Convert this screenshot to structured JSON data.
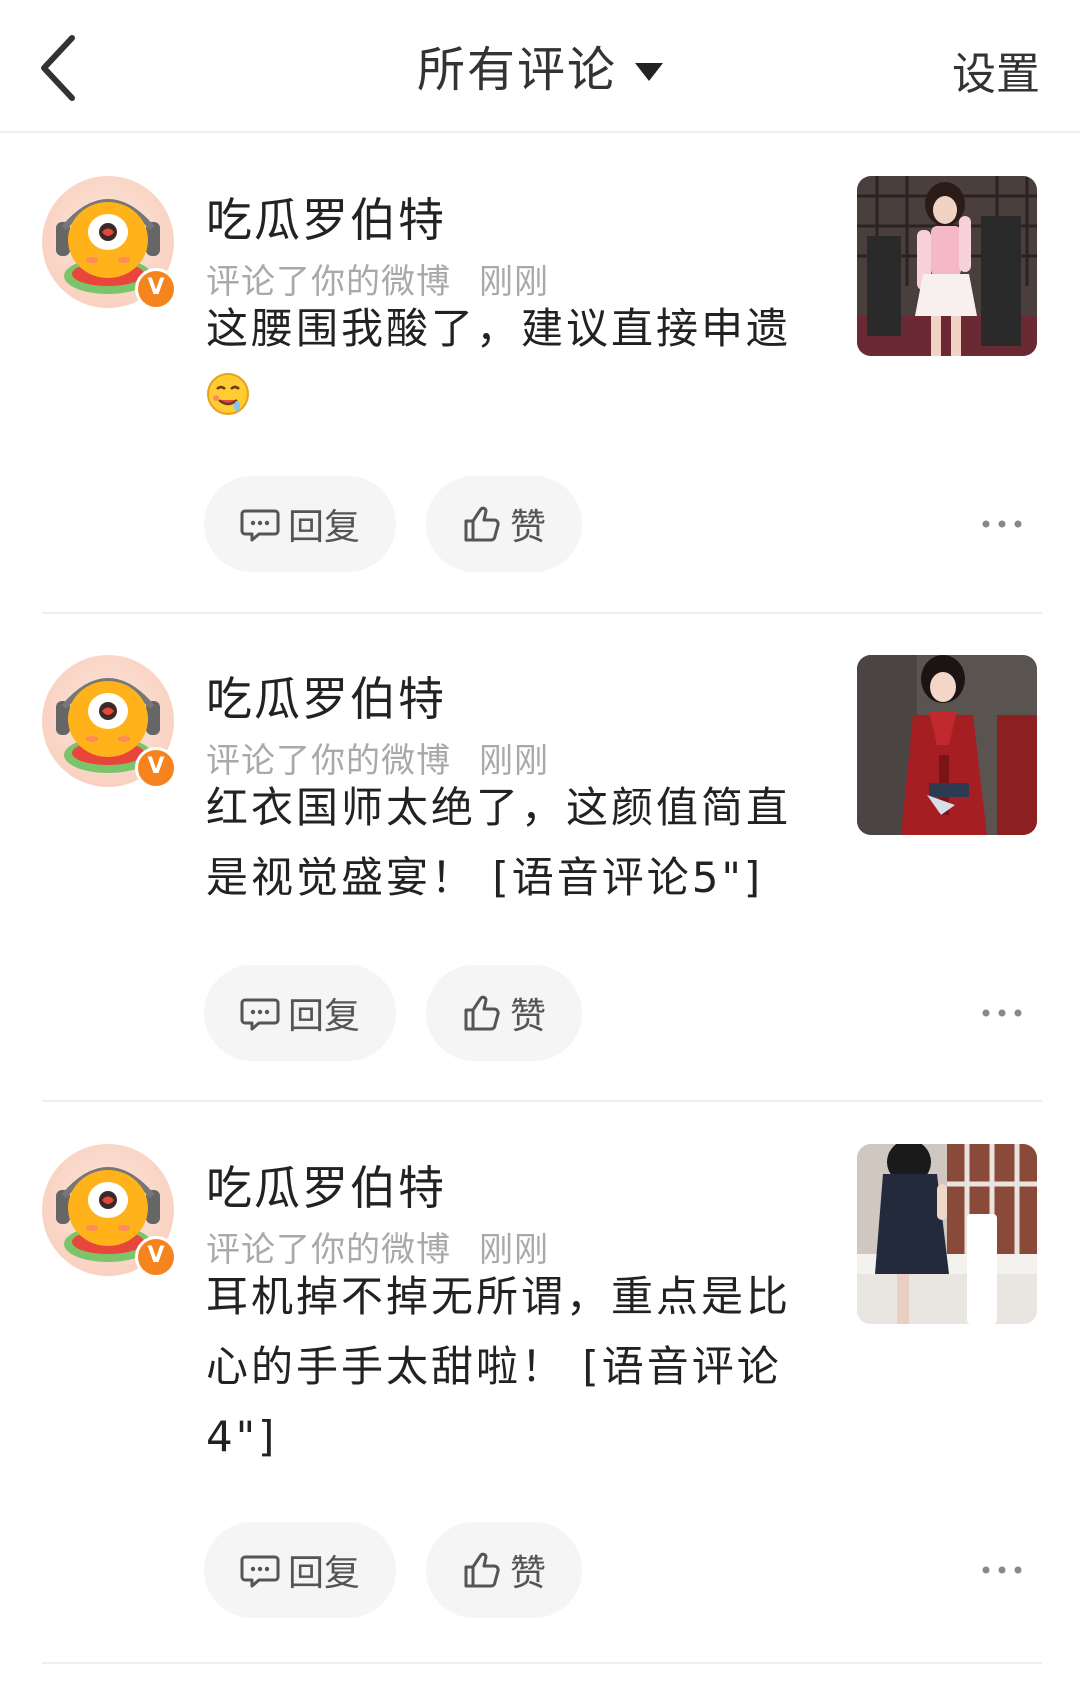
{
  "header": {
    "title": "所有评论",
    "settings_label": "设置"
  },
  "comments": [
    {
      "user": "吃瓜罗伯特",
      "action": "评论了你的微博",
      "time": "刚刚",
      "text": "这腰围我酸了，建议直接申遗",
      "emoji": "drooling-face-emoji",
      "reply_label": "回复",
      "like_label": "赞"
    },
    {
      "user": "吃瓜罗伯特",
      "action": "评论了你的微博",
      "time": "刚刚",
      "text": "红衣国师太绝了，这颜值简直是视觉盛宴！ [语音评论5\"]",
      "reply_label": "回复",
      "like_label": "赞"
    },
    {
      "user": "吃瓜罗伯特",
      "action": "评论了你的微博",
      "time": "刚刚",
      "text": "耳机掉不掉无所谓，重点是比心的手手太甜啦！ [语音评论4\"]",
      "reply_label": "回复",
      "like_label": "赞"
    }
  ],
  "colors": {
    "accent_badge": "#f5841f",
    "pill_bg": "#f5f5f5",
    "meta_text": "#a9a9a9"
  }
}
